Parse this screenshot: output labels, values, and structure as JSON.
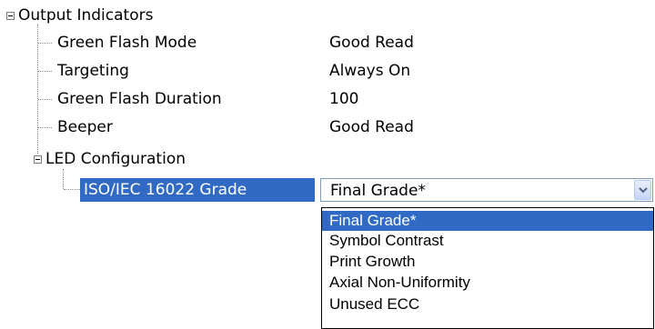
{
  "tree": {
    "root_label": "Output Indicators",
    "rows": [
      {
        "label": "Green Flash Mode",
        "value": "Good Read"
      },
      {
        "label": "Targeting",
        "value": "Always On"
      },
      {
        "label": "Green Flash Duration",
        "value": "100"
      },
      {
        "label": "Beeper",
        "value": "Good Read"
      }
    ],
    "led_group_label": "LED Configuration",
    "selected_item_label": "ISO/IEC 16022 Grade"
  },
  "combo": {
    "value": "Final Grade*",
    "icon": "chevron-down-icon"
  },
  "dropdown": {
    "options": [
      "Final Grade*",
      "Symbol Contrast",
      "Print Growth",
      "Axial Non-Uniformity",
      "Unused ECC"
    ],
    "selected_index": 0
  },
  "colors": {
    "selection": "#316ac5",
    "combo_border": "#7f9db9"
  }
}
